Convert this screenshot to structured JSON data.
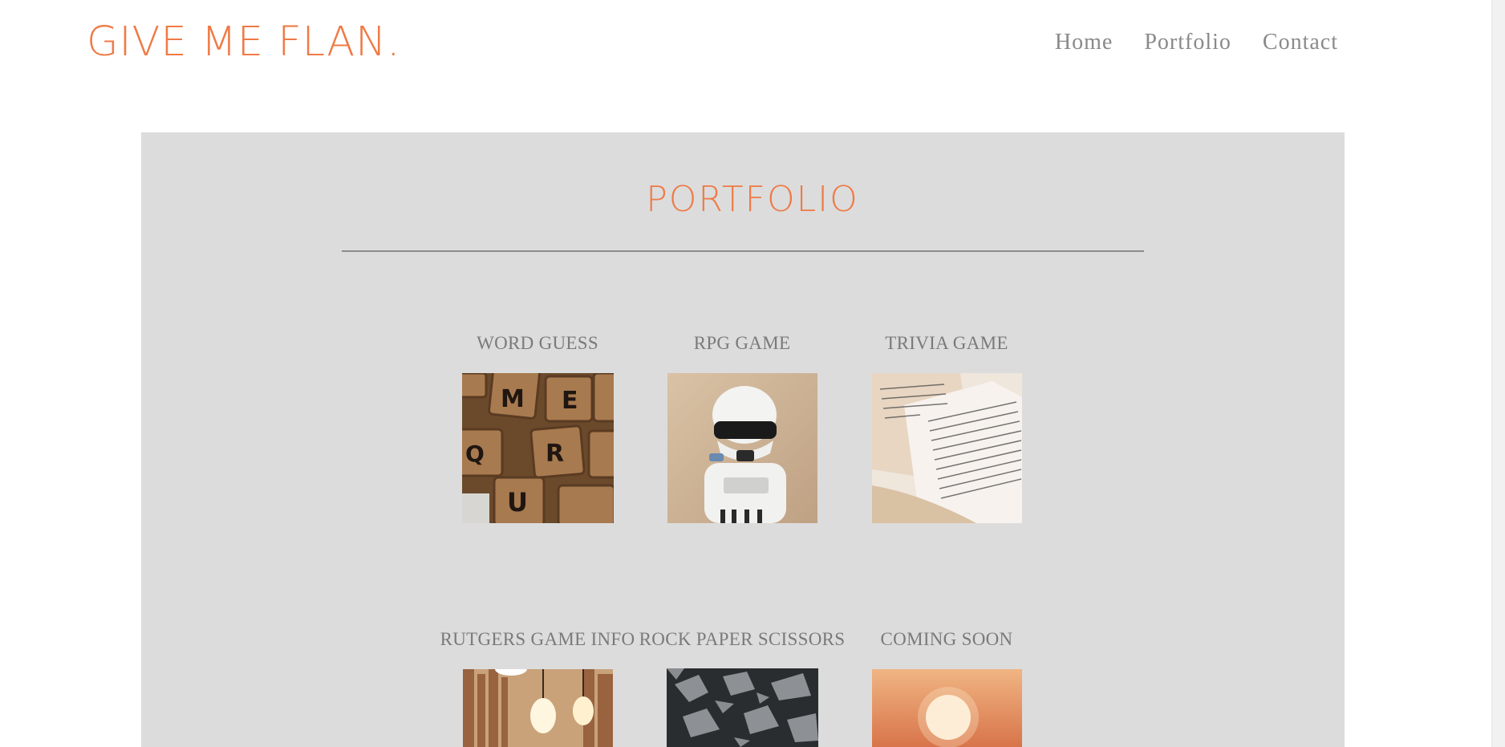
{
  "brand": {
    "text": "GIVE ME FLAN."
  },
  "nav": {
    "items": [
      "Home",
      "Portfolio",
      "Contact"
    ]
  },
  "portfolio": {
    "title": "PORTFOLIO",
    "projects": [
      {
        "title": "WORD GUESS",
        "image": "scrabble-tiles-image"
      },
      {
        "title": "RPG GAME",
        "image": "stormtrooper-toy-image"
      },
      {
        "title": "TRIVIA GAME",
        "image": "open-book-pages-image"
      },
      {
        "title": "RUTGERS GAME INFO",
        "image": "library-bulbs-image"
      },
      {
        "title": "ROCK PAPER SCISSORS",
        "image": "dark-rocks-image"
      },
      {
        "title": "COMING SOON",
        "image": "sunset-image"
      }
    ]
  },
  "colors": {
    "accent": "#ef7a45",
    "panel": "#dcdcdc",
    "text": "#7a7a7a"
  }
}
